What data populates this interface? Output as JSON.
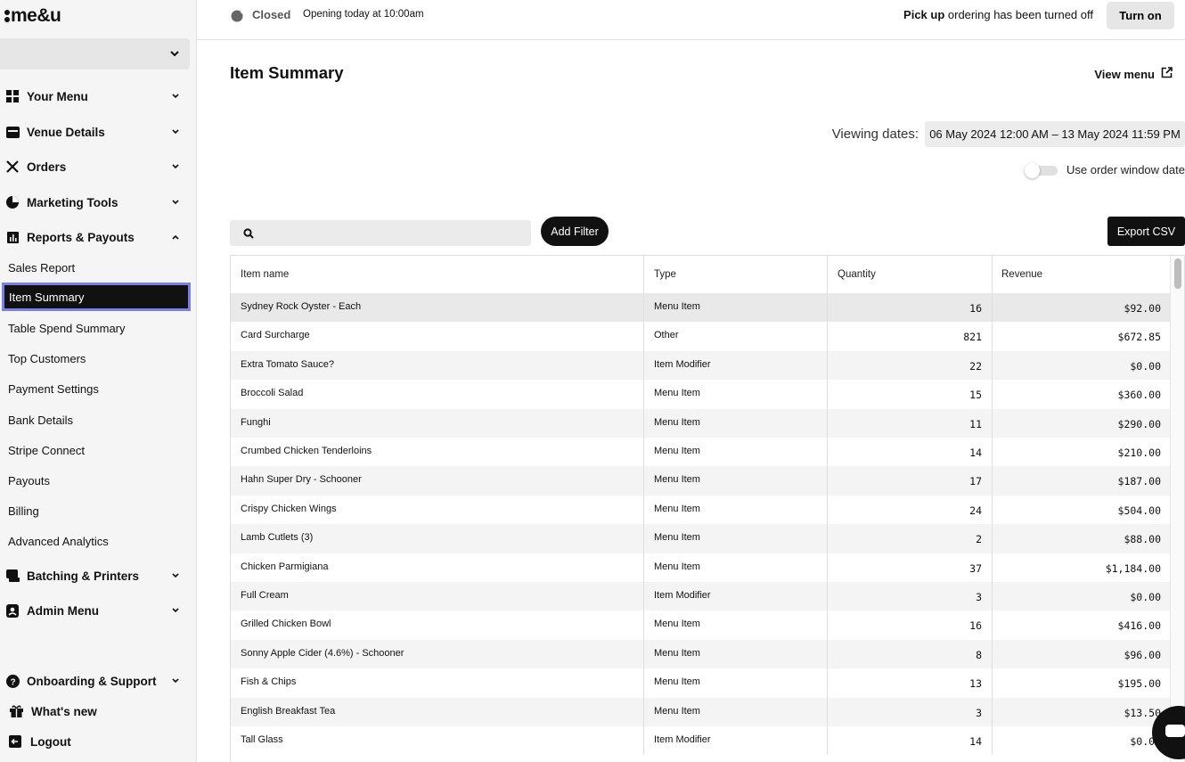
{
  "brand": {
    "logo_text": "me&u"
  },
  "venue_select": {
    "value": ""
  },
  "nav": {
    "sections": [
      {
        "label": "Your Menu"
      },
      {
        "label": "Venue Details"
      },
      {
        "label": "Orders"
      },
      {
        "label": "Marketing Tools"
      },
      {
        "label": "Reports & Payouts"
      }
    ],
    "reports_items": [
      {
        "label": "Sales Report"
      },
      {
        "label": "Item Summary"
      },
      {
        "label": "Table Spend Summary"
      },
      {
        "label": "Top Customers"
      },
      {
        "label": "Payment Settings"
      },
      {
        "label": "Bank Details"
      },
      {
        "label": "Stripe Connect"
      },
      {
        "label": "Payouts"
      },
      {
        "label": "Billing"
      },
      {
        "label": "Advanced Analytics"
      }
    ],
    "after_sections": [
      {
        "label": "Batching & Printers"
      },
      {
        "label": "Admin Menu"
      }
    ],
    "bottom": {
      "support": "Onboarding & Support",
      "whats_new": "What's new",
      "logout": "Logout"
    }
  },
  "topbar": {
    "status": "Closed",
    "opening": "Opening today at 10:00am",
    "pickup_bold": "Pick up",
    "pickup_rest": " ordering has been turned off",
    "turn_on": "Turn on"
  },
  "main": {
    "title": "Item Summary",
    "view_menu": "View menu",
    "viewing_dates_label": "Viewing dates:",
    "date_range": "06 May 2024 12:00 AM – 13 May 2024 11:59 PM",
    "toggle_label": "Use order window date",
    "toggle_on": false,
    "search_placeholder": "",
    "add_filter": "Add Filter",
    "export_csv": "Export CSV"
  },
  "table": {
    "headers": [
      "Item name",
      "Type",
      "Quantity",
      "Revenue"
    ],
    "rows": [
      [
        "Sydney Rock Oyster - Each",
        "Menu Item",
        "16",
        "$92.00"
      ],
      [
        "Card Surcharge",
        "Other",
        "821",
        "$672.85"
      ],
      [
        "Extra Tomato Sauce?",
        "Item Modifier",
        "22",
        "$0.00"
      ],
      [
        "Broccoli Salad",
        "Menu Item",
        "15",
        "$360.00"
      ],
      [
        "Funghi",
        "Menu Item",
        "11",
        "$290.00"
      ],
      [
        "Crumbed Chicken Tenderloins",
        "Menu Item",
        "14",
        "$210.00"
      ],
      [
        "Hahn Super Dry - Schooner",
        "Menu Item",
        "17",
        "$187.00"
      ],
      [
        "Crispy Chicken Wings",
        "Menu Item",
        "24",
        "$504.00"
      ],
      [
        "Lamb Cutlets (3)",
        "Menu Item",
        "2",
        "$88.00"
      ],
      [
        "Chicken Parmigiana",
        "Menu Item",
        "37",
        "$1,184.00"
      ],
      [
        "Full Cream",
        "Item Modifier",
        "3",
        "$0.00"
      ],
      [
        "Grilled Chicken Bowl",
        "Menu Item",
        "16",
        "$416.00"
      ],
      [
        "Sonny Apple Cider (4.6%) - Schooner",
        "Menu Item",
        "8",
        "$96.00"
      ],
      [
        "Fish & Chips",
        "Menu Item",
        "13",
        "$195.00"
      ],
      [
        "English Breakfast Tea",
        "Menu Item",
        "3",
        "$13.50"
      ],
      [
        "Tall Glass",
        "Item Modifier",
        "14",
        "$0.00"
      ]
    ]
  },
  "colors": {
    "accent": "#111111",
    "active_outline": "#7b80e8",
    "sidebar_bg": "#f5f5f5"
  }
}
